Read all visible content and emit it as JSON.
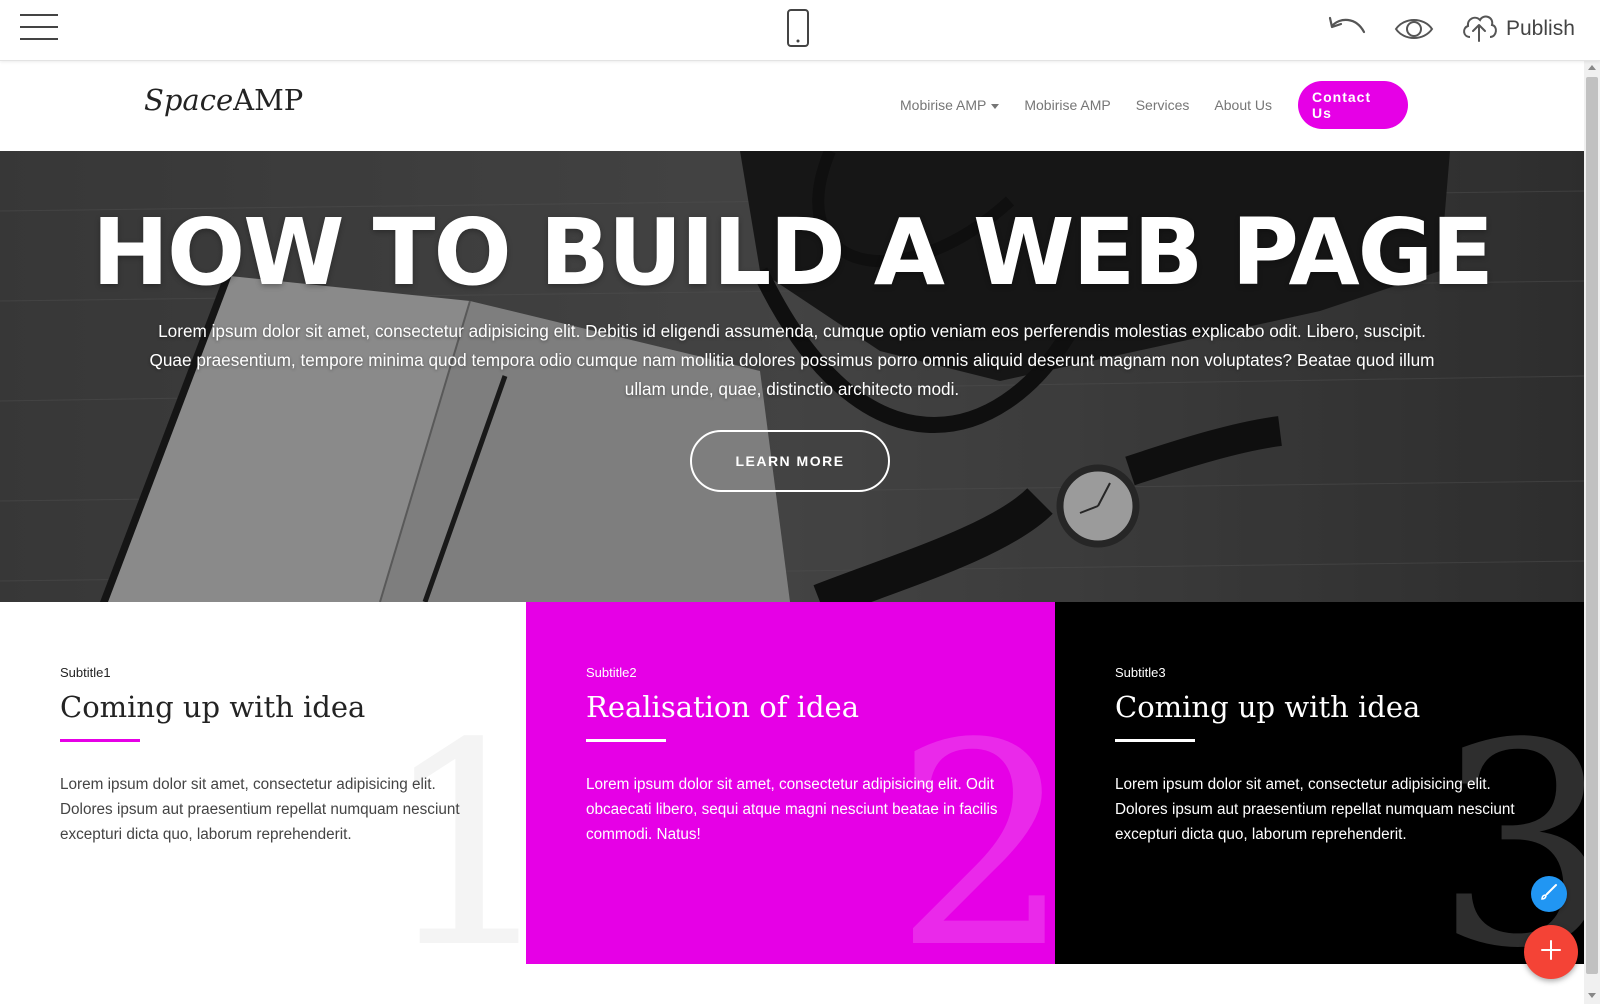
{
  "editor": {
    "menu_icon": "hamburger-menu-icon",
    "device_icon": "mobile-phone-icon",
    "undo_icon": "undo-icon",
    "preview_icon": "eye-icon",
    "publish_icon": "cloud-upload-icon",
    "publish_label": "Publish"
  },
  "site": {
    "brand_italic": "Space",
    "brand_regular": "AMP",
    "nav": {
      "dropdown_label": "Mobirise AMP",
      "link_1": "Mobirise AMP",
      "link_2": "Services",
      "link_3": "About Us",
      "contact_label": "Contact Us"
    }
  },
  "hero": {
    "title": "HOW TO BUILD A WEB PAGE",
    "text": "Lorem ipsum dolor sit amet, consectetur adipisicing elit. Debitis id eligendi assumenda, cumque optio veniam eos perferendis molestias explicabo odit. Libero, suscipit. Quae praesentium, tempore minima quod tempora odio cumque nam mollitia dolores possimus porro omnis aliquid deserunt magnam non voluptates? Beatae quod illum ullam unde, quae, distinctio architecto modi.",
    "button_label": "LEARN MORE"
  },
  "features": [
    {
      "number": "1",
      "subtitle": "Subtitle1",
      "title": "Coming up with idea",
      "text": "Lorem ipsum dolor sit amet, consectetur adipisicing elit. Dolores ipsum aut praesentium repellat numquam nesciunt excepturi dicta quo, laborum reprehenderit."
    },
    {
      "number": "2",
      "subtitle": "Subtitle2",
      "title": "Realisation of idea",
      "text": "Lorem ipsum dolor sit amet, consectetur adipisicing elit. Odit obcaecati libero, sequi atque magni nesciunt beatae in facilis commodi. Natus!"
    },
    {
      "number": "3",
      "subtitle": "Subtitle3",
      "title": "Coming up with idea",
      "text": "Lorem ipsum dolor sit amet, consectetur adipisicing elit. Dolores ipsum aut praesentium repellat numquam nesciunt excepturi dicta quo, laborum reprehenderit."
    }
  ],
  "fabs": {
    "brush_icon": "paint-brush-icon",
    "add_icon": "plus-icon"
  },
  "colors": {
    "accent": "#e600e6",
    "dark": "#000000",
    "fab_red": "#f44336",
    "fab_blue": "#2196f3"
  }
}
